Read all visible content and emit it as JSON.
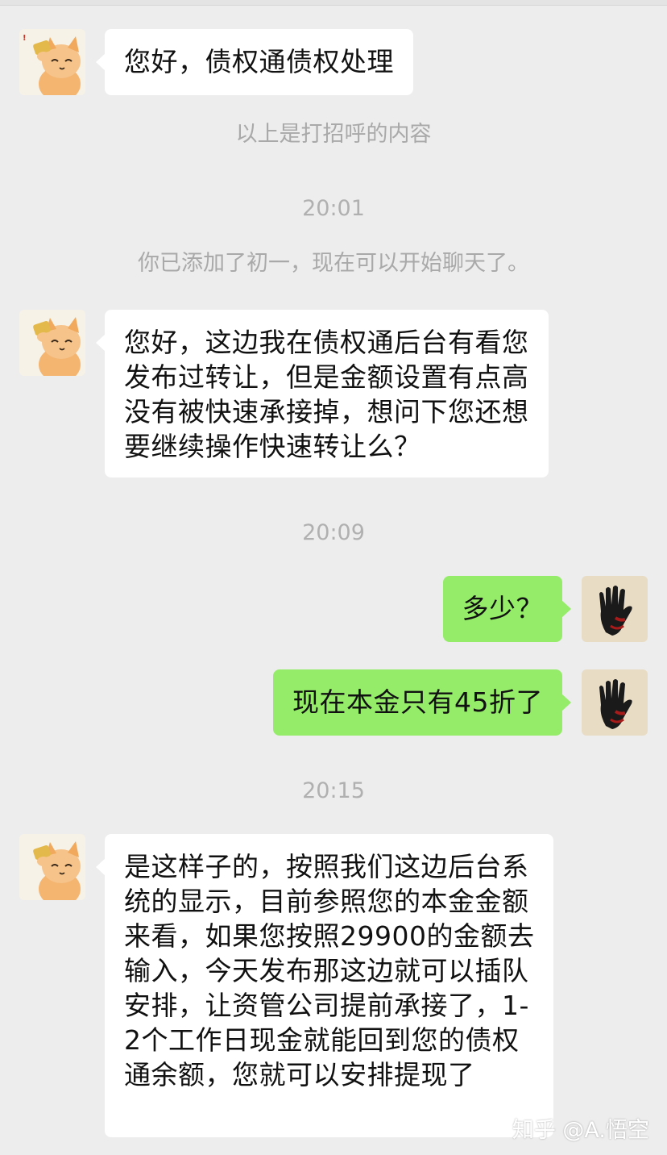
{
  "chat": {
    "messages": [
      {
        "side": "left",
        "sender": "cat-avatar",
        "lines": [
          "您好，债权通债权处理"
        ]
      },
      {
        "type": "system",
        "text": "以上是打招呼的内容"
      },
      {
        "type": "time",
        "text": "20:01"
      },
      {
        "type": "system",
        "text": "你已添加了初一，现在可以开始聊天了。"
      },
      {
        "side": "left",
        "sender": "cat-avatar",
        "lines": [
          "您好，这边我在债权通后台有看您",
          "发布过转让，但是金额设置有点高",
          "没有被快速承接掉，想问下您还想",
          "要继续操作快速转让么？"
        ]
      },
      {
        "type": "time",
        "text": "20:09"
      },
      {
        "side": "right",
        "sender": "hand-avatar",
        "lines": [
          "多少？"
        ]
      },
      {
        "side": "right",
        "sender": "hand-avatar",
        "lines": [
          "现在本金只有45折了"
        ]
      },
      {
        "type": "time",
        "text": "20:15"
      },
      {
        "side": "left",
        "sender": "cat-avatar",
        "lines": [
          "是这样子的，按照我们这边后台系",
          "统的显示，目前参照您的本金金额",
          "来看，如果您按照29900的金额去",
          "输入，今天发布那这边就可以插队",
          "安排，让资管公司提前承接了，1-",
          "2个工作日现金就能回到您的债权",
          "通余额，您就可以安排提现了"
        ]
      }
    ]
  },
  "watermark": "知乎 @A.悟空",
  "colors": {
    "background": "#ededed",
    "incoming_bubble": "#ffffff",
    "outgoing_bubble": "#95ec69",
    "system_text": "#a9a9a9"
  }
}
